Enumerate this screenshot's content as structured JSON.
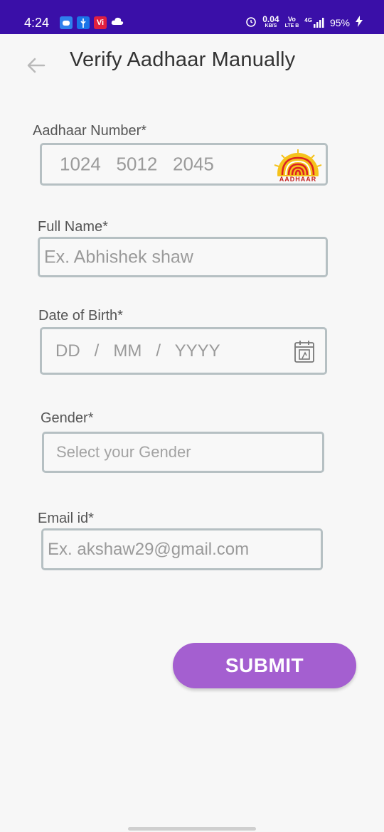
{
  "status_bar": {
    "time": "4:24",
    "network_speed": "0.04",
    "network_unit": "KB/S",
    "volte_top": "Vo",
    "volte_bottom": "LTE B",
    "signal": "4G",
    "battery": "95%",
    "vi_label": "Vi",
    "colors": {
      "background": "#3a0fa8"
    }
  },
  "header": {
    "title": "Verify Aadhaar Manually"
  },
  "form": {
    "aadhaar": {
      "label": "Aadhaar Number*",
      "placeholder": "1024   5012   2045",
      "logo_text": "AADHAAR"
    },
    "full_name": {
      "label": "Full Name*",
      "placeholder": "Ex. Abhishek shaw"
    },
    "dob": {
      "label": "Date of Birth*",
      "placeholder": "DD   /   MM   /   YYYY"
    },
    "gender": {
      "label": "Gender*",
      "placeholder": "Select your Gender"
    },
    "email": {
      "label": "Email id*",
      "placeholder": "Ex. akshaw29@gmail.com"
    }
  },
  "submit": {
    "label": "SUBMIT",
    "color": "#a45fd0"
  }
}
